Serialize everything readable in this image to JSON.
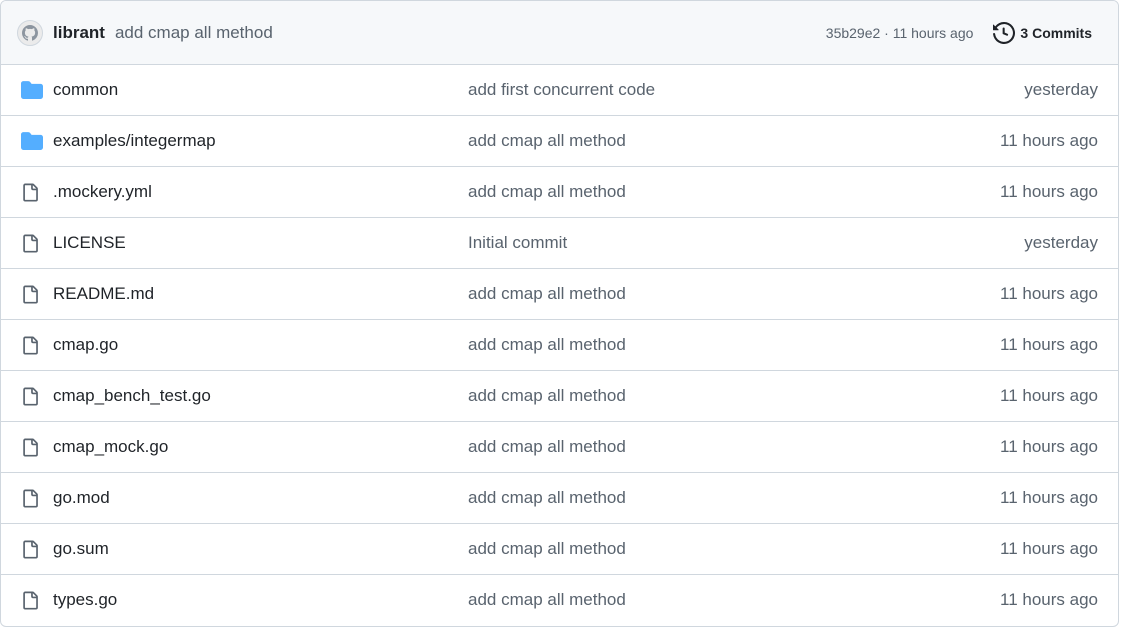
{
  "header": {
    "author": "librant",
    "message": "add cmap all method",
    "sha_time": "35b29e2 · 11 hours ago",
    "commits_label": "3 Commits",
    "avatar_icon": "github-avatar-icon",
    "history_icon": "history-clock-icon"
  },
  "colors": {
    "folder": "#54aeff",
    "file_outline": "#59636e",
    "muted_text": "#59636e",
    "border": "#d0d7de",
    "header_bg": "#f6f8fa"
  },
  "files": [
    {
      "name": "common",
      "type": "folder",
      "message": "add first concurrent code",
      "time": "yesterday"
    },
    {
      "name": "examples/integermap",
      "type": "folder",
      "message": "add cmap all method",
      "time": "11 hours ago"
    },
    {
      "name": ".mockery.yml",
      "type": "file",
      "message": "add cmap all method",
      "time": "11 hours ago"
    },
    {
      "name": "LICENSE",
      "type": "file",
      "message": "Initial commit",
      "time": "yesterday"
    },
    {
      "name": "README.md",
      "type": "file",
      "message": "add cmap all method",
      "time": "11 hours ago"
    },
    {
      "name": "cmap.go",
      "type": "file",
      "message": "add cmap all method",
      "time": "11 hours ago"
    },
    {
      "name": "cmap_bench_test.go",
      "type": "file",
      "message": "add cmap all method",
      "time": "11 hours ago"
    },
    {
      "name": "cmap_mock.go",
      "type": "file",
      "message": "add cmap all method",
      "time": "11 hours ago"
    },
    {
      "name": "go.mod",
      "type": "file",
      "message": "add cmap all method",
      "time": "11 hours ago"
    },
    {
      "name": "go.sum",
      "type": "file",
      "message": "add cmap all method",
      "time": "11 hours ago"
    },
    {
      "name": "types.go",
      "type": "file",
      "message": "add cmap all method",
      "time": "11 hours ago"
    }
  ]
}
